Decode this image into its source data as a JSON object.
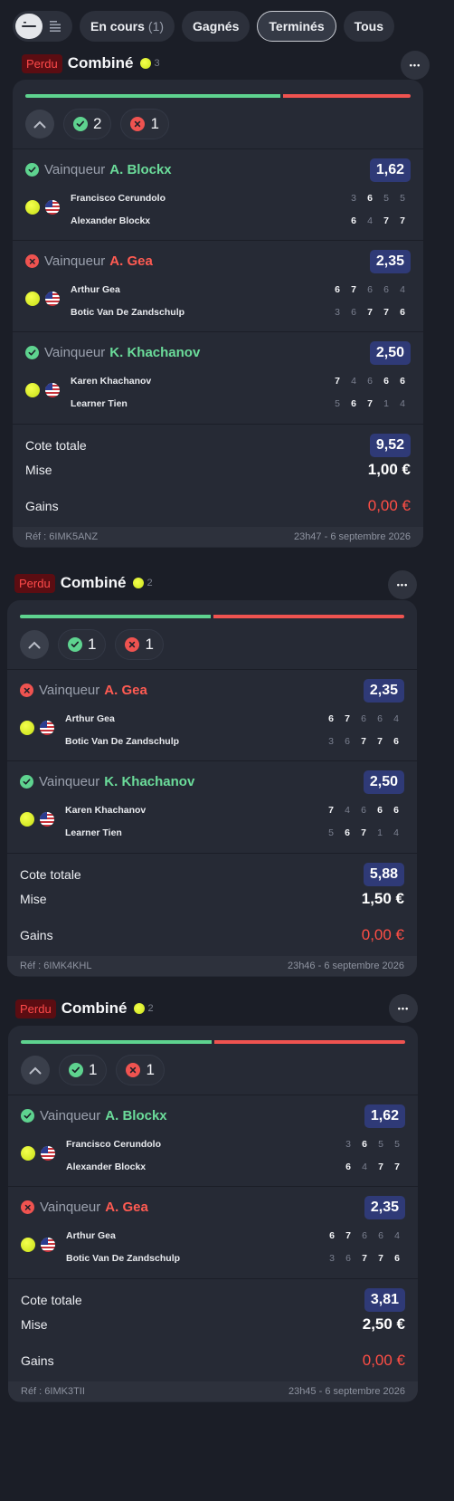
{
  "filters": {
    "view_list_icon": "list-compact-icon",
    "view_detail_icon": "list-detail-icon",
    "tabs": [
      {
        "label": "En cours",
        "count": "(1)"
      },
      {
        "label": "Gagnés"
      },
      {
        "label": "Terminés"
      },
      {
        "label": "Tous"
      }
    ],
    "active_tab": "Terminés"
  },
  "colors": {
    "win": "#5ed38f",
    "loss": "#ef5350",
    "odds_bg": "#2f3a77",
    "lost_badge": "#5b0d12"
  },
  "bets": [
    {
      "status": "Perdu",
      "type": "Combiné",
      "count": "3",
      "won_count": "2",
      "lost_count": "1",
      "selections": [
        {
          "result": "won",
          "market": "Vainqueur",
          "pick": "A. Blockx",
          "odds": "1,62",
          "players": [
            "Francisco Cerundolo",
            "Alexander Blockx"
          ],
          "scores": [
            [
              "3",
              "6",
              "5",
              "5"
            ],
            [
              "6",
              "4",
              "7",
              "7"
            ]
          ],
          "bold": [
            [
              false,
              true,
              false,
              false
            ],
            [
              true,
              false,
              true,
              true
            ]
          ]
        },
        {
          "result": "lost",
          "market": "Vainqueur",
          "pick": "A. Gea",
          "odds": "2,35",
          "players": [
            "Arthur Gea",
            "Botic Van De Zandschulp"
          ],
          "scores": [
            [
              "6",
              "7",
              "6",
              "6",
              "4"
            ],
            [
              "3",
              "6",
              "7",
              "7",
              "6"
            ]
          ],
          "bold": [
            [
              true,
              true,
              false,
              false,
              false
            ],
            [
              false,
              false,
              true,
              true,
              true
            ]
          ]
        },
        {
          "result": "won",
          "market": "Vainqueur",
          "pick": "K. Khachanov",
          "odds": "2,50",
          "players": [
            "Karen Khachanov",
            "Learner Tien"
          ],
          "scores": [
            [
              "7",
              "4",
              "6",
              "6",
              "6"
            ],
            [
              "5",
              "6",
              "7",
              "1",
              "4"
            ]
          ],
          "bold": [
            [
              true,
              false,
              false,
              true,
              true
            ],
            [
              false,
              true,
              true,
              false,
              false
            ]
          ]
        }
      ],
      "total_label": "Cote totale",
      "total_odds": "9,52",
      "stake_label": "Mise",
      "stake": "1,00 €",
      "gain_label": "Gains",
      "gain": "0,00 €",
      "ref": "Réf : 6IMK5ANZ",
      "date": "23h47 - 6 septembre 2026"
    },
    {
      "status": "Perdu",
      "type": "Combiné",
      "count": "2",
      "won_count": "1",
      "lost_count": "1",
      "selections": [
        {
          "result": "lost",
          "market": "Vainqueur",
          "pick": "A. Gea",
          "odds": "2,35",
          "players": [
            "Arthur Gea",
            "Botic Van De Zandschulp"
          ],
          "scores": [
            [
              "6",
              "7",
              "6",
              "6",
              "4"
            ],
            [
              "3",
              "6",
              "7",
              "7",
              "6"
            ]
          ],
          "bold": [
            [
              true,
              true,
              false,
              false,
              false
            ],
            [
              false,
              false,
              true,
              true,
              true
            ]
          ]
        },
        {
          "result": "won",
          "market": "Vainqueur",
          "pick": "K. Khachanov",
          "odds": "2,50",
          "players": [
            "Karen Khachanov",
            "Learner Tien"
          ],
          "scores": [
            [
              "7",
              "4",
              "6",
              "6",
              "6"
            ],
            [
              "5",
              "6",
              "7",
              "1",
              "4"
            ]
          ],
          "bold": [
            [
              true,
              false,
              false,
              true,
              true
            ],
            [
              false,
              true,
              true,
              false,
              false
            ]
          ]
        }
      ],
      "total_label": "Cote totale",
      "total_odds": "5,88",
      "stake_label": "Mise",
      "stake": "1,50 €",
      "gain_label": "Gains",
      "gain": "0,00 €",
      "ref": "Réf : 6IMK4KHL",
      "date": "23h46 - 6 septembre 2026"
    },
    {
      "status": "Perdu",
      "type": "Combiné",
      "count": "2",
      "won_count": "1",
      "lost_count": "1",
      "selections": [
        {
          "result": "won",
          "market": "Vainqueur",
          "pick": "A. Blockx",
          "odds": "1,62",
          "players": [
            "Francisco Cerundolo",
            "Alexander Blockx"
          ],
          "scores": [
            [
              "3",
              "6",
              "5",
              "5"
            ],
            [
              "6",
              "4",
              "7",
              "7"
            ]
          ],
          "bold": [
            [
              false,
              true,
              false,
              false
            ],
            [
              true,
              false,
              true,
              true
            ]
          ]
        },
        {
          "result": "lost",
          "market": "Vainqueur",
          "pick": "A. Gea",
          "odds": "2,35",
          "players": [
            "Arthur Gea",
            "Botic Van De Zandschulp"
          ],
          "scores": [
            [
              "6",
              "7",
              "6",
              "6",
              "4"
            ],
            [
              "3",
              "6",
              "7",
              "7",
              "6"
            ]
          ],
          "bold": [
            [
              true,
              true,
              false,
              false,
              false
            ],
            [
              false,
              false,
              true,
              true,
              true
            ]
          ]
        }
      ],
      "total_label": "Cote totale",
      "total_odds": "3,81",
      "stake_label": "Mise",
      "stake": "2,50 €",
      "gain_label": "Gains",
      "gain": "0,00 €",
      "ref": "Réf : 6IMK3TII",
      "date": "23h45 - 6 septembre 2026"
    }
  ]
}
